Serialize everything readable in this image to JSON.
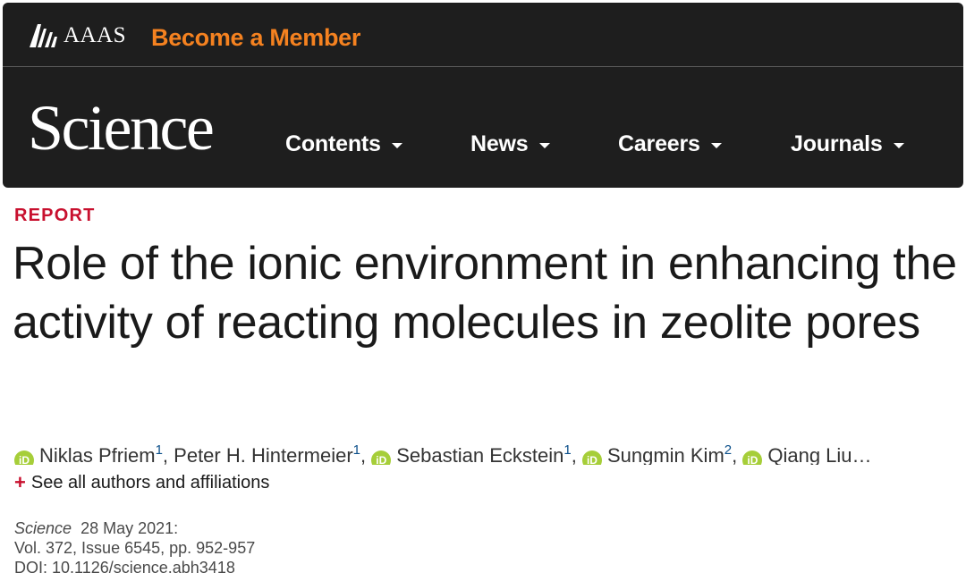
{
  "header": {
    "org_name": "AAAS",
    "cta": "Become a Member",
    "logo": "Science",
    "nav": [
      {
        "label": "Contents"
      },
      {
        "label": "News"
      },
      {
        "label": "Careers"
      },
      {
        "label": "Journals"
      }
    ],
    "colors": {
      "bar": "#1e1e1e",
      "cta": "#f58220"
    }
  },
  "article": {
    "type": "REPORT",
    "title": "Role of the ionic environment in enhancing the activity of reacting molecules in zeolite pores",
    "orcid_label": "iD",
    "authors": [
      {
        "name": "Niklas Pfriem",
        "aff": "1",
        "orcid": true,
        "sep": ", "
      },
      {
        "name": "Peter H. Hintermeier",
        "aff": "1",
        "orcid": false,
        "sep": ", "
      },
      {
        "name": "Sebastian Eckstein",
        "aff": "1",
        "orcid": true,
        "sep": ", "
      },
      {
        "name": "Sungmin Kim",
        "aff": "2",
        "orcid": true,
        "sep": ", "
      },
      {
        "name": "Qiang Liu",
        "aff": "",
        "orcid": true,
        "sep": ""
      }
    ],
    "ellipsis": "…",
    "see_all": "See all authors and affiliations",
    "see_all_icon": "plus-icon",
    "citation": {
      "journal": "Science",
      "date": "28 May 2021:",
      "volume": "Vol. 372, Issue 6545, pp. 952-957",
      "doi": "DOI: 10.1126/science.abh3418"
    },
    "colors": {
      "report": "#c8102e",
      "orcid": "#a6ce39"
    }
  }
}
